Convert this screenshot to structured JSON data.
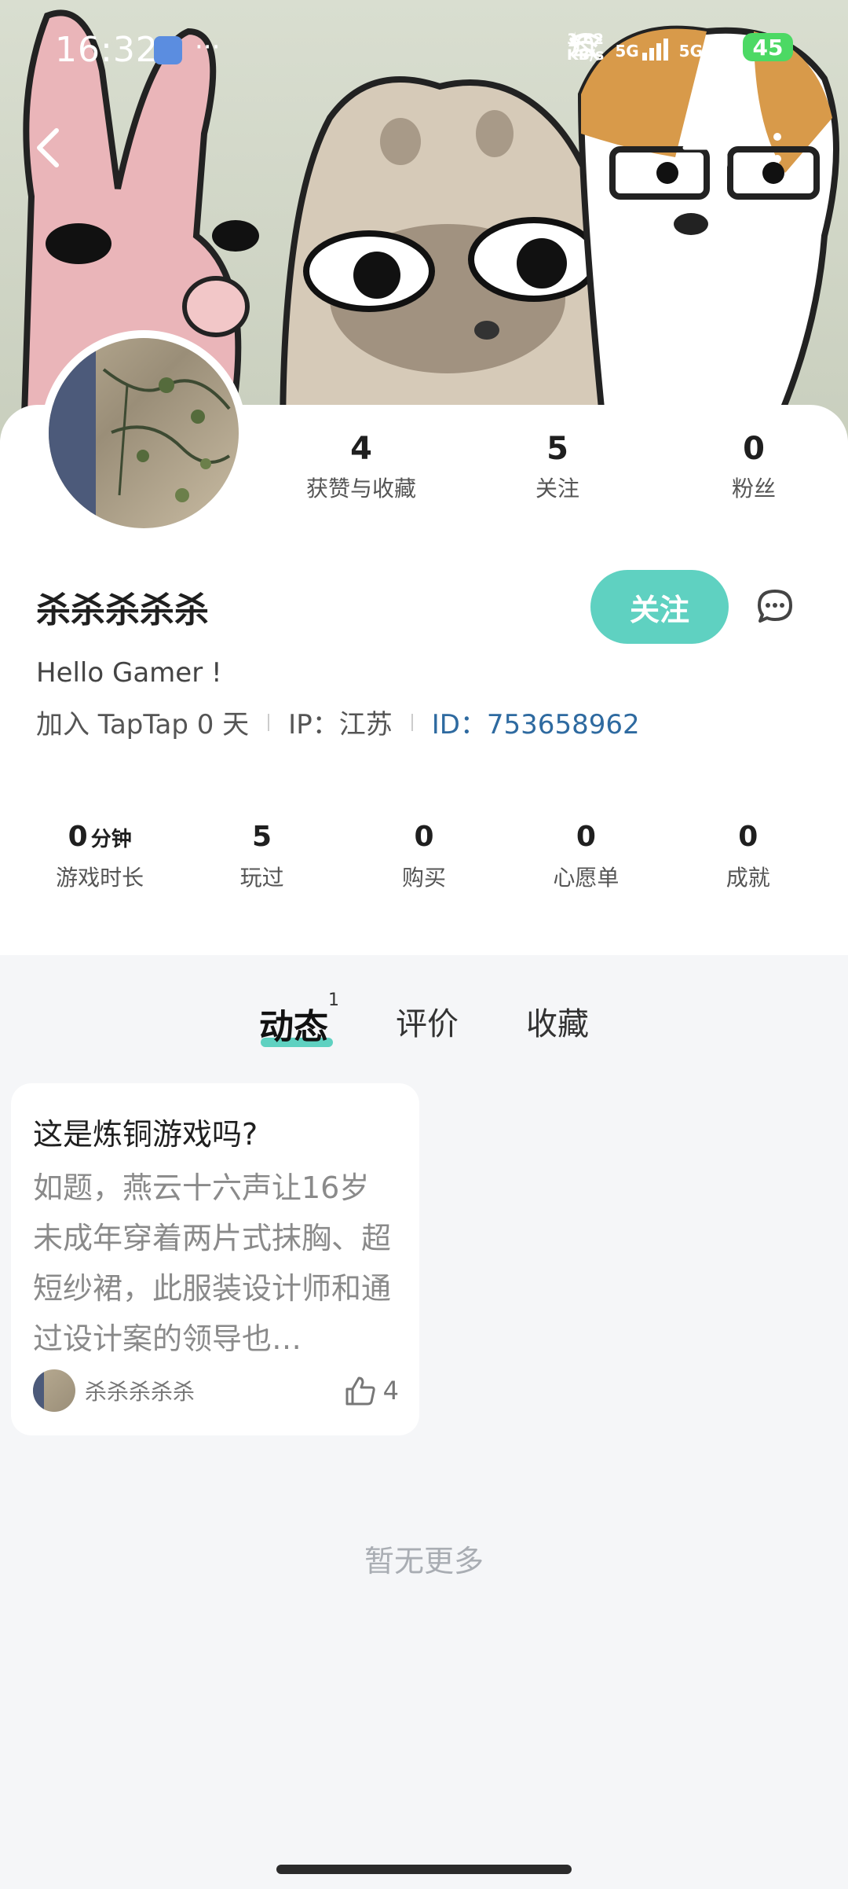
{
  "status_bar": {
    "time": "16:32",
    "dots": "···",
    "speed_top": "3.62",
    "speed_bottom": "KB/s",
    "net1": "5G",
    "net2": "5G",
    "battery": "45"
  },
  "nav": {
    "back_icon": "chevron-left-icon",
    "scan_icon": "scan-icon",
    "more_icon": "more-vertical-icon"
  },
  "profile": {
    "name": "杀杀杀杀杀",
    "bio": "Hello Gamer !",
    "joined": "加入 TapTap 0 天",
    "ip": "IP：江苏",
    "id": "ID：753658962",
    "follow_label": "关注"
  },
  "stats": [
    {
      "num": "4",
      "label": "获赞与收藏"
    },
    {
      "num": "5",
      "label": "关注"
    },
    {
      "num": "0",
      "label": "粉丝"
    }
  ],
  "game_stats": {
    "playtime": {
      "num": "0",
      "unit": "分钟",
      "label": "游戏时长"
    },
    "played": {
      "num": "5",
      "label": "玩过"
    },
    "bought": {
      "num": "0",
      "label": "购买"
    },
    "wishlist": {
      "num": "0",
      "label": "心愿单"
    },
    "achievements": {
      "num": "0",
      "label": "成就"
    }
  },
  "tabs": {
    "moments": "动态",
    "moments_count": "1",
    "reviews": "评价",
    "favorites": "收藏"
  },
  "post": {
    "title": "这是炼铜游戏吗?",
    "body": "如题，燕云十六声让16岁未成年穿着两片式抹胸、超短纱裙，此服装设计师和通过设计案的领导也…",
    "author": "杀杀杀杀杀",
    "likes": "4"
  },
  "footer": {
    "no_more": "暂无更多"
  },
  "colors": {
    "accent": "#5fd1c1",
    "id_link": "#2e6aa0",
    "background": "#f5f6f8"
  }
}
